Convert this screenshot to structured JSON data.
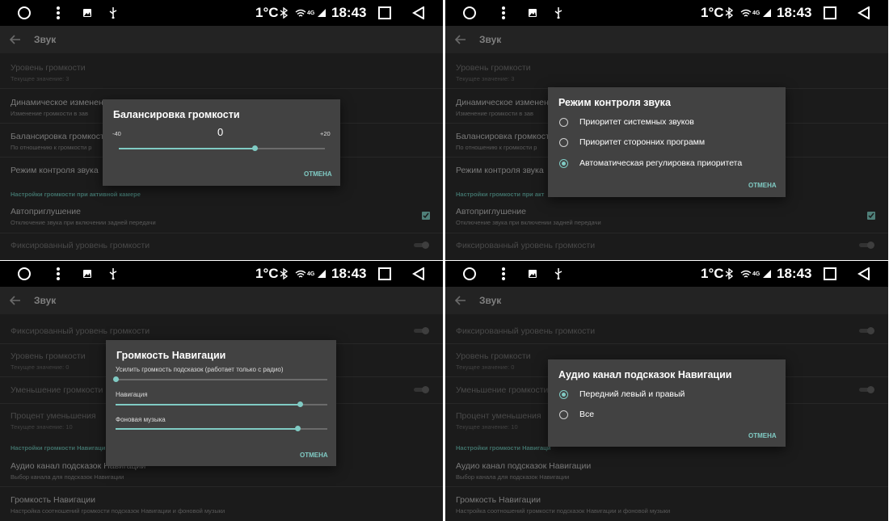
{
  "statusbar": {
    "temperature": "1°C",
    "network": "4G",
    "time": "18:43",
    "icons": [
      "home-circle-icon",
      "menu-dots-icon",
      "image-icon",
      "usb-icon",
      "bluetooth-icon",
      "wifi-icon",
      "signal-icon",
      "recent-apps-icon",
      "back-triangle-icon"
    ]
  },
  "colors": {
    "accent": "#80cbc4",
    "dialog": "#424242",
    "background": "#1b1b1b"
  },
  "screen_title": "Звук",
  "panels": [
    {
      "settings": [
        {
          "title": "Уровень громкости",
          "subtitle": "Текущее значение: 3"
        },
        {
          "title": "Динамическое изменение",
          "subtitle": "Изменение громкости в зав"
        },
        {
          "title": "Балансировка громкости",
          "subtitle": "По отношению к громкости р"
        },
        {
          "title": "Режим контроля звука"
        }
      ],
      "section": "Настройки громкости при активной камере",
      "mute": {
        "title": "Автоприглушение",
        "subtitle": "Отключение звука при включении задней передачи",
        "checked": true
      },
      "fixed_volume": {
        "title": "Фиксированный уровень громкости",
        "on": false
      },
      "dialog": {
        "title": "Балансировка громкости",
        "min": "-40",
        "value": "0",
        "max": "+20",
        "level": 0.66,
        "cancel": "ОТМЕНА"
      }
    },
    {
      "settings": [
        {
          "title": "Уровень громкости",
          "subtitle": "Текущее значение: 3"
        },
        {
          "title": "Динамическое изменение",
          "subtitle": "Изменение громкости в зав"
        },
        {
          "title": "Балансировка громкост",
          "subtitle": "По отношению к громкости р"
        },
        {
          "title": "Режим контроля звука"
        }
      ],
      "section": "Настройки громкости при акт",
      "mute": {
        "title": "Автоприглушение",
        "subtitle": "Отключение звука при включении задней передачи",
        "checked": true
      },
      "fixed_volume": {
        "title": "Фиксированный уровень громкости",
        "on": false
      },
      "dialog": {
        "title": "Режим контроля звука",
        "options": [
          {
            "label": "Приоритет системных звуков",
            "selected": false
          },
          {
            "label": "Приоритет сторонних программ",
            "selected": false
          },
          {
            "label": "Автоматическая регулировка приоритета",
            "selected": true
          }
        ],
        "cancel": "ОТМЕНА"
      }
    },
    {
      "settings": [
        {
          "title": "Фиксированный уровень громкости",
          "toggle": false
        },
        {
          "title": "Уровень громкости",
          "subtitle": "Текущее значение: 0"
        },
        {
          "title": "Уменьшение громкости н",
          "toggle": false
        },
        {
          "title": "Процент уменьшения",
          "subtitle": "Текущее значение: 10"
        }
      ],
      "section": "Настройки громкости Навигаци",
      "nav_channel": {
        "title": "Аудио канал подсказок Навигации",
        "subtitle": "Выбор канала для подсказок Навигации"
      },
      "nav_volume": {
        "title": "Громкость Навигации",
        "subtitle": "Настройка соотношений громкости подсказок Навигации и фоновой музыки"
      },
      "dialog": {
        "title": "Громкость Навигации",
        "sliders": [
          {
            "label": "Усилить громкость подсказок (работает только с радио)",
            "level": 0.0
          },
          {
            "label": "Навигация",
            "level": 0.87
          },
          {
            "label": "Фоновая музыка",
            "level": 0.86
          }
        ],
        "cancel": "ОТМЕНА"
      }
    },
    {
      "settings": [
        {
          "title": "Фиксированный уровень громкости",
          "toggle": false
        },
        {
          "title": "Уровень громкости",
          "subtitle": "Текущее значение: 0"
        },
        {
          "title": "Уменьшение громкости н",
          "toggle": false
        },
        {
          "title": "Процент уменьшения",
          "subtitle": "Текущее значение: 10"
        }
      ],
      "section": "Настройки громкости Навигаци",
      "nav_channel": {
        "title": "Аудио канал подсказок Навигации",
        "subtitle": "Выбор канала для подсказок Навигации"
      },
      "nav_volume": {
        "title": "Громкость Навигации",
        "subtitle": "Настройка соотношений громкости подсказок Навигации и фоновой музыки"
      },
      "dialog": {
        "title": "Аудио канал подсказок Навигации",
        "options": [
          {
            "label": "Передний левый и правый",
            "selected": true
          },
          {
            "label": "Все",
            "selected": false
          }
        ],
        "cancel": "ОТМЕНА"
      }
    }
  ]
}
